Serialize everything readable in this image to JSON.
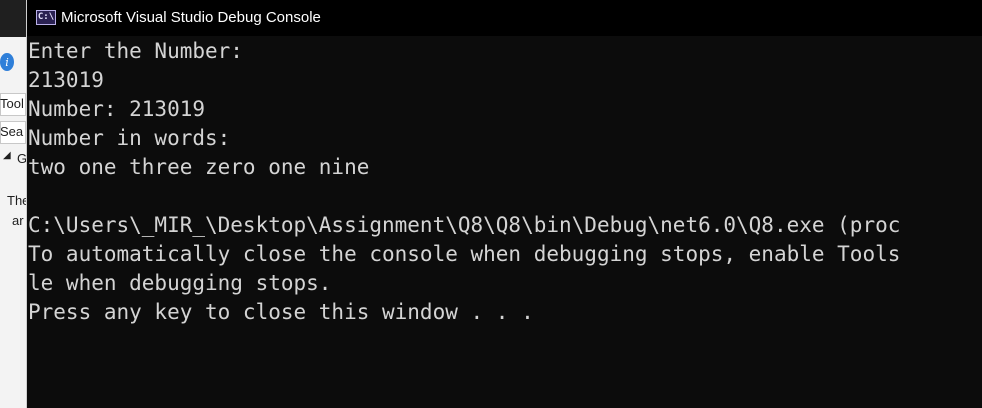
{
  "ide": {
    "labels": [
      "Tool",
      "Sea",
      "G",
      "The",
      "ar"
    ]
  },
  "console": {
    "icon_text": "C:\\",
    "title": "Microsoft Visual Studio Debug Console",
    "lines": [
      "Enter the Number:",
      "213019",
      "Number: 213019",
      "Number in words:",
      "two one three zero one nine",
      "",
      "C:\\Users\\_MIR_\\Desktop\\Assignment\\Q8\\Q8\\bin\\Debug\\net6.0\\Q8.exe (proc",
      "To automatically close the console when debugging stops, enable Tools",
      "le when debugging stops.",
      "Press any key to close this window . . ."
    ]
  }
}
